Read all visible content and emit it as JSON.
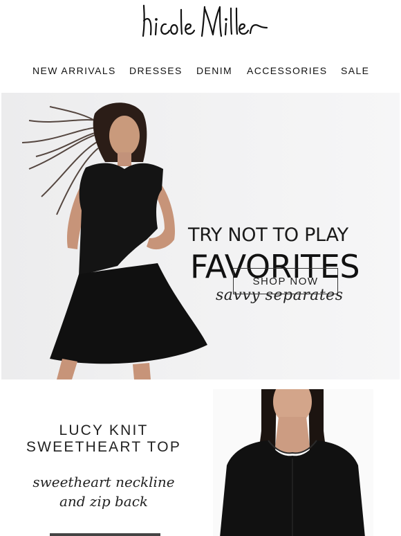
{
  "brand": {
    "logo_text": "Nicole Miller"
  },
  "nav": {
    "items": [
      {
        "label": "NEW ARRIVALS"
      },
      {
        "label": "DRESSES"
      },
      {
        "label": "DENIM"
      },
      {
        "label": "ACCESSORIES"
      },
      {
        "label": "SALE"
      }
    ]
  },
  "hero": {
    "line1": "TRY NOT TO PLAY",
    "line2": "FAVORITES",
    "script": "savvy separates",
    "cta": "SHOP NOW"
  },
  "product": {
    "title_line1": "LUCY KNIT",
    "title_line2": "SWEETHEART TOP",
    "script_line1": "sweetheart neckline",
    "script_line2": "and zip back"
  }
}
